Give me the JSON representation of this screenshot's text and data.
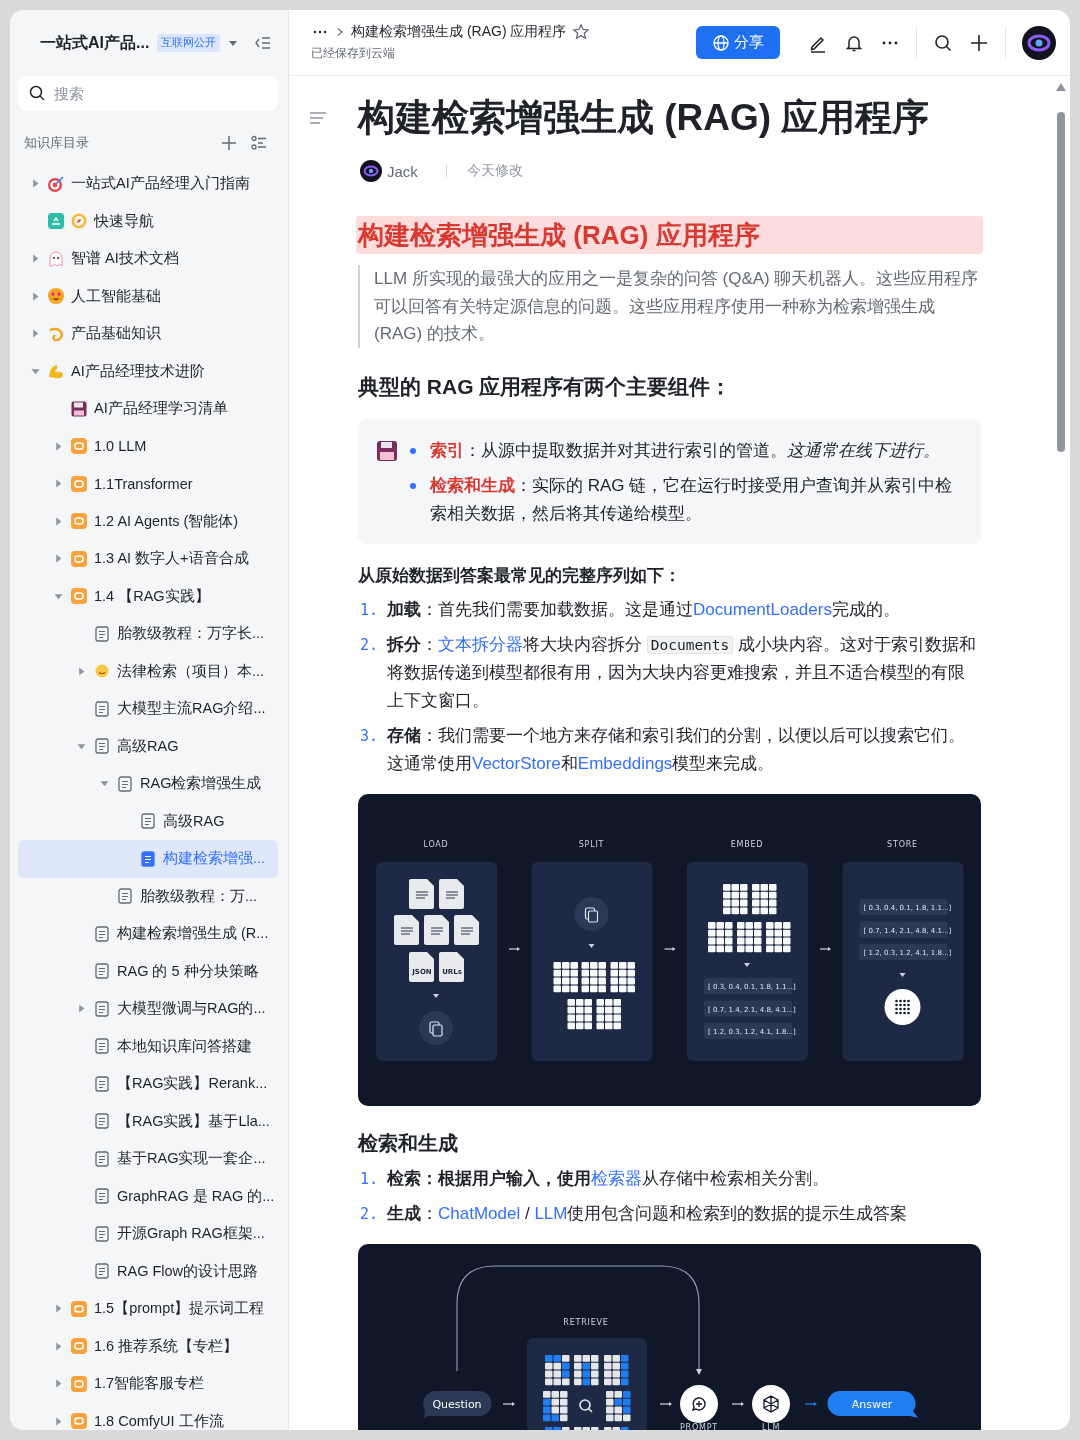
{
  "sidebar": {
    "title": "一站式AI产品...",
    "badge": "互联网公开",
    "search_placeholder": "搜索",
    "section_label": "知识库目录",
    "tree": [
      {
        "label": "一站式AI产品经理入门指南",
        "kind": "target",
        "expanded": false,
        "selected": false
      },
      {
        "label": "快速导航",
        "kind": "shortcut",
        "selected": false
      },
      {
        "label": "智谱 AI技术文档",
        "kind": "ghost",
        "expanded": false,
        "selected": false
      },
      {
        "label": "人工智能基础",
        "kind": "face",
        "expanded": false,
        "selected": false
      },
      {
        "label": "产品基础知识",
        "kind": "swirl",
        "expanded": false,
        "selected": false
      },
      {
        "label": "AI产品经理技术进阶",
        "kind": "arm",
        "expanded": true,
        "selected": false,
        "children": [
          {
            "label": "AI产品经理学习清单",
            "kind": "floppy",
            "selected": false
          },
          {
            "label": "1.0 LLM",
            "kind": "tile",
            "expanded": false,
            "selected": false
          },
          {
            "label": "1.1Transformer",
            "kind": "tile",
            "expanded": false,
            "selected": false
          },
          {
            "label": "1.2 AI Agents (智能体)",
            "kind": "tile",
            "expanded": false,
            "selected": false
          },
          {
            "label": "1.3 AI 数字人+语音合成",
            "kind": "tile",
            "expanded": false,
            "selected": false
          },
          {
            "label": "1.4 【RAG实践】",
            "kind": "tile",
            "expanded": true,
            "selected": false,
            "children": [
              {
                "label": "胎教级教程：万字长...",
                "kind": "doc",
                "selected": false
              },
              {
                "label": "法律检索（项目）本...",
                "kind": "smiley",
                "expanded": false,
                "selected": false
              },
              {
                "label": "大模型主流RAG介绍...",
                "kind": "doc",
                "selected": false
              },
              {
                "label": "高级RAG",
                "kind": "doc",
                "expanded": true,
                "selected": false,
                "children": [
                  {
                    "label": "RAG检索增强生成",
                    "kind": "doc",
                    "expanded": true,
                    "selected": false,
                    "children": [
                      {
                        "label": "高级RAG",
                        "kind": "doc",
                        "selected": false
                      },
                      {
                        "label": "构建检索增强...",
                        "kind": "doc",
                        "selected": true
                      }
                    ]
                  },
                  {
                    "label": "胎教级教程：万...",
                    "kind": "doc",
                    "selected": false
                  }
                ]
              },
              {
                "label": "构建检索增强生成 (R...",
                "kind": "doc",
                "selected": false
              },
              {
                "label": "RAG 的 5 种分块策略",
                "kind": "doc",
                "selected": false
              },
              {
                "label": "大模型微调与RAG的...",
                "kind": "doc",
                "expanded": false,
                "selected": false
              },
              {
                "label": "本地知识库问答搭建",
                "kind": "doc",
                "selected": false
              },
              {
                "label": "【RAG实践】Rerank...",
                "kind": "doc",
                "selected": false
              },
              {
                "label": "【RAG实践】基于Lla...",
                "kind": "doc",
                "selected": false
              },
              {
                "label": "基于RAG实现一套企...",
                "kind": "doc",
                "selected": false
              },
              {
                "label": "GraphRAG 是 RAG 的...",
                "kind": "doc",
                "selected": false
              },
              {
                "label": "开源Graph RAG框架...",
                "kind": "doc",
                "selected": false
              },
              {
                "label": "RAG Flow的设计思路",
                "kind": "doc",
                "selected": false
              }
            ]
          },
          {
            "label": "1.5【prompt】提示词工程",
            "kind": "tile",
            "expanded": false,
            "selected": false
          },
          {
            "label": "1.6 推荐系统【专栏】",
            "kind": "tile",
            "expanded": false,
            "selected": false
          },
          {
            "label": "1.7智能客服专栏",
            "kind": "tile",
            "expanded": false,
            "selected": false
          },
          {
            "label": "1.8 ComfyUI 工作流",
            "kind": "tile",
            "expanded": false,
            "selected": false
          }
        ]
      }
    ]
  },
  "topbar": {
    "doc_title": "构建检索增强生成 (RAG) 应用程序",
    "starred": false,
    "save_status": "已经保存到云端",
    "share_label": "分享"
  },
  "doc": {
    "title": "构建检索增强生成 (RAG) 应用程序",
    "author": "Jack",
    "modified": "今天修改",
    "blocks": [
      {
        "kind": "highlight-heading",
        "text": "构建检索增强生成 (RAG) 应用程序"
      },
      {
        "kind": "quote",
        "text": "LLM 所实现的最强大的应用之一是复杂的问答 (Q&A) 聊天机器人。这些应用程序可以回答有关特定源信息的问题。这些应用程序使用一种称为检索增强生成 (RAG) 的技术。"
      },
      {
        "kind": "heading",
        "text": "典型的 RAG 应用程序有两个主要组件："
      },
      {
        "kind": "callout",
        "items": [
          [
            {
              "kind": "bold",
              "text": "索引"
            },
            {
              "kind": "plain",
              "text": "：从源中提取数据并对其进行索引的管道。"
            },
            {
              "kind": "italic",
              "text": "这通常在线下进行。"
            }
          ],
          [
            {
              "kind": "bold",
              "text": "检索和生成"
            },
            {
              "kind": "plain",
              "text": "：实际的 RAG 链，它在运行时接受用户查询并从索引中检索相关数据，然后将其传递给模型。"
            }
          ]
        ]
      },
      {
        "kind": "bold-paragraph",
        "text": "从原始数据到答案最常见的完整序列如下："
      },
      {
        "kind": "ordered-list",
        "items": [
          {
            "number": "1.",
            "segments": [
              {
                "kind": "bold",
                "text": "加载"
              },
              {
                "kind": "plain",
                "text": "：首先我们需要加载数据。这是通过"
              },
              {
                "kind": "link",
                "text": "DocumentLoaders"
              },
              {
                "kind": "plain",
                "text": "完成的。"
              }
            ]
          },
          {
            "number": "2.",
            "segments": [
              {
                "kind": "bold",
                "text": "拆分"
              },
              {
                "kind": "plain",
                "text": "："
              },
              {
                "kind": "link",
                "text": "文本拆分器"
              },
              {
                "kind": "plain",
                "text": "将大块内容拆分 "
              },
              {
                "kind": "code",
                "text": "Documents"
              },
              {
                "kind": "plain",
                "text": " 成小块内容。这对于索引数据和将数据传递到模型都很有用，因为大块内容更难搜索，并且不适合模型的有限上下文窗口。"
              }
            ]
          },
          {
            "number": "3.",
            "segments": [
              {
                "kind": "bold",
                "text": "存储"
              },
              {
                "kind": "plain",
                "text": "：我们需要一个地方来存储和索引我们的分割，以便以后可以搜索它们。这通常使用"
              },
              {
                "kind": "link",
                "text": "VectorStore"
              },
              {
                "kind": "plain",
                "text": "和"
              },
              {
                "kind": "link",
                "text": "Embeddings"
              },
              {
                "kind": "plain",
                "text": "模型来完成。"
              }
            ]
          }
        ]
      },
      {
        "kind": "pipeline-diagram",
        "stages": [
          {
            "kind": "load",
            "label": "LOAD",
            "file_tags": [
              "JSON",
              "URLs"
            ]
          },
          {
            "kind": "split",
            "label": "SPLIT"
          },
          {
            "kind": "embed",
            "label": "EMBED",
            "vectors": [
              "[ 0.3, 0.4, 0.1, 1.8, 1.1...]",
              "[ 0.7, 1.4, 2.1, 4.8, 4.1...]",
              "[ 1.2, 0.3, 1.2, 4.1, 1.8...]"
            ]
          },
          {
            "kind": "store",
            "label": "STORE",
            "vectors": [
              "[ 0.3, 0.4, 0.1, 1.8, 1.1...]",
              "[ 0.7, 1.4, 2.1, 4.8, 4.1...]",
              "[ 1.2, 0.3, 1.2, 4.1, 1.8...]"
            ]
          }
        ]
      },
      {
        "kind": "subheading",
        "text": "检索和生成"
      },
      {
        "kind": "ordered-list",
        "items": [
          {
            "number": "1.",
            "segments": [
              {
                "kind": "bold",
                "text": "检索：根据用户输入，使用"
              },
              {
                "kind": "link",
                "text": "检索器"
              },
              {
                "kind": "plain",
                "text": "从存储中检索相关分割。"
              }
            ]
          },
          {
            "number": "2.",
            "segments": [
              {
                "kind": "bold",
                "text": "生成"
              },
              {
                "kind": "plain",
                "text": "："
              },
              {
                "kind": "link",
                "text": "ChatModel"
              },
              {
                "kind": "plain",
                "text": " / "
              },
              {
                "kind": "link",
                "text": "LLM"
              },
              {
                "kind": "plain",
                "text": "使用包含问题和检索到的数据的提示生成答案"
              }
            ]
          }
        ]
      },
      {
        "kind": "retrieval-diagram",
        "retrieve_label": "RETRIEVE",
        "question": "Question",
        "prompt_label": "PROMPT",
        "llm_label": "LLM",
        "answer": "Answer"
      }
    ]
  }
}
